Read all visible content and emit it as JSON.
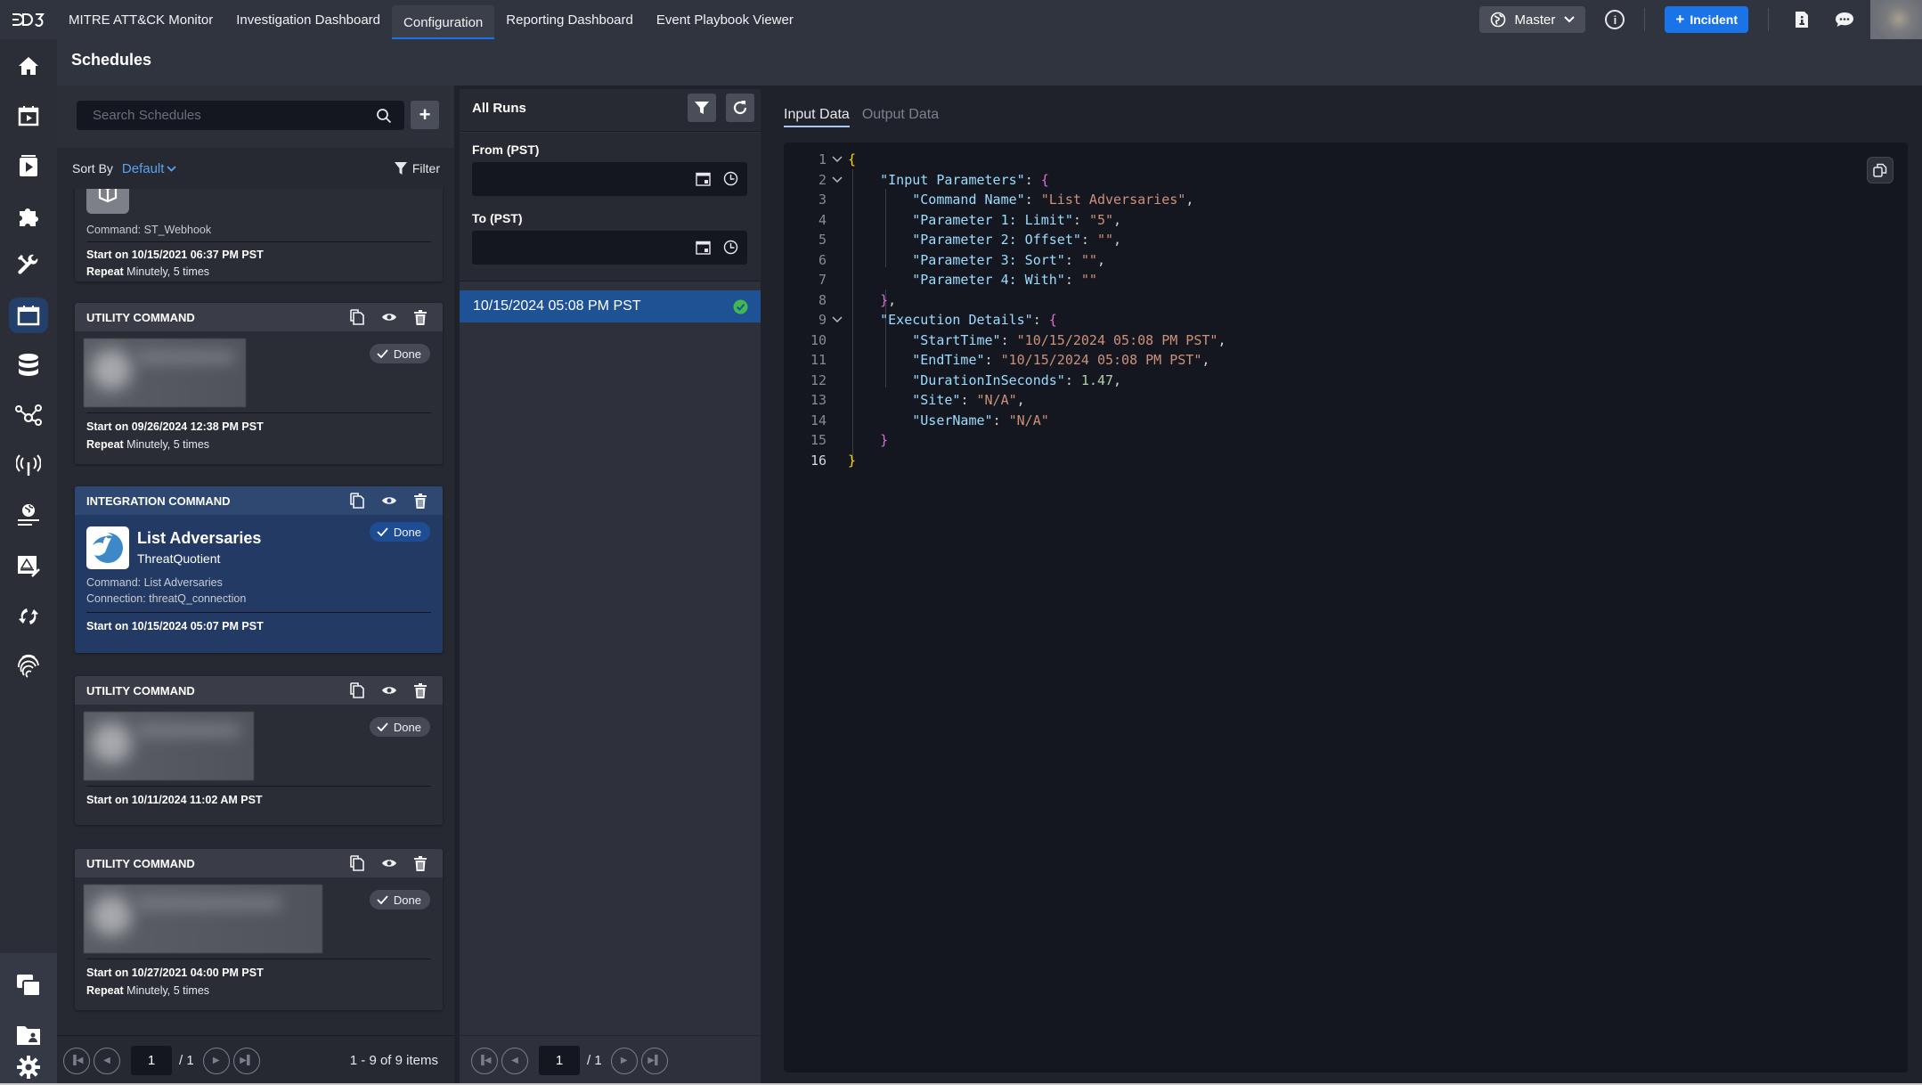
{
  "topbar": {
    "logo": "D3",
    "tabs": [
      {
        "label": "MITRE ATT&CK Monitor",
        "active": false
      },
      {
        "label": "Investigation Dashboard",
        "active": false
      },
      {
        "label": "Configuration",
        "active": true
      },
      {
        "label": "Reporting Dashboard",
        "active": false
      },
      {
        "label": "Event Playbook Viewer",
        "active": false
      }
    ],
    "site_selector": "Master",
    "incident_button": "Incident",
    "icons": [
      "globe-icon",
      "info-icon",
      "plus-icon",
      "document-info-icon",
      "chat-icon",
      "user-avatar"
    ]
  },
  "leftrail": {
    "items": [
      {
        "icon": "home-icon"
      },
      {
        "icon": "calendar-play-icon"
      },
      {
        "icon": "playbook-icon"
      },
      {
        "icon": "puzzle-icon"
      },
      {
        "icon": "tools-icon"
      },
      {
        "icon": "calendar-icon",
        "active": true
      },
      {
        "icon": "database-icon"
      },
      {
        "icon": "network-icon"
      },
      {
        "icon": "antenna-icon"
      },
      {
        "icon": "globe-desk-icon"
      },
      {
        "icon": "alert-edit-icon"
      },
      {
        "icon": "sync-icon"
      },
      {
        "icon": "fingerprint-icon"
      }
    ],
    "bottom_items": [
      {
        "icon": "windows-icon"
      },
      {
        "icon": "user-folder-icon"
      },
      {
        "icon": "gear-icon"
      }
    ]
  },
  "page": {
    "title": "Schedules"
  },
  "schedules": {
    "search_placeholder": "Search Schedules",
    "search_value": "",
    "sort_label": "Sort By",
    "sort_value": "Default",
    "filter_label": "Filter",
    "cards": [
      {
        "title_partial": "–",
        "command": "Command: ST_Webhook",
        "start": "Start on 10/15/2021 06:37 PM PST",
        "repeat_label": "Repeat",
        "repeat_value": "Minutely, 5 times"
      },
      {
        "type": "UTILITY COMMAND",
        "status": "Done",
        "start": "Start on 09/26/2024 12:38 PM PST",
        "repeat_label": "Repeat",
        "repeat_value": "Minutely, 5 times"
      },
      {
        "type": "INTEGRATION COMMAND",
        "status": "Done",
        "name": "List Adversaries",
        "integration": "ThreatQuotient",
        "command": "Command: List Adversaries",
        "connection": "Connection: threatQ_connection",
        "start": "Start on 10/15/2024 05:07 PM PST",
        "selected": true
      },
      {
        "type": "UTILITY COMMAND",
        "status": "Done",
        "start": "Start on 10/11/2024 11:02 AM PST"
      },
      {
        "type": "UTILITY COMMAND",
        "status": "Done",
        "start": "Start on 10/27/2021 04:00 PM PST",
        "repeat_label": "Repeat",
        "repeat_value": "Minutely, 5 times"
      }
    ],
    "pager": {
      "page": "1",
      "total": "/ 1",
      "count": "1 - 9 of 9 items"
    }
  },
  "runs": {
    "title": "All Runs",
    "from_label": "From (PST)",
    "from_value": "",
    "to_label": "To (PST)",
    "to_value": "",
    "items": [
      {
        "time": "10/15/2024 05:08 PM PST",
        "status": "success",
        "selected": true
      }
    ],
    "pager": {
      "page": "1",
      "total": "/ 1"
    }
  },
  "detail": {
    "tabs": [
      {
        "label": "Input Data",
        "active": true
      },
      {
        "label": "Output Data",
        "active": false
      }
    ],
    "json": {
      "Input Parameters": {
        "Command Name": "List Adversaries",
        "Parameter 1: Limit": "5",
        "Parameter 2: Offset": "",
        "Parameter 3: Sort": "",
        "Parameter 4: With": ""
      },
      "Execution Details": {
        "StartTime": "10/15/2024 05:08 PM PST",
        "EndTime": "10/15/2024 05:08 PM PST",
        "DurationInSeconds": 1.47,
        "Site": "N/A",
        "UserName": "N/A"
      }
    },
    "line_count": 16,
    "current_line": 16
  },
  "colors": {
    "accent": "#1a73e8",
    "selected_card": "#233b64",
    "selected_run": "#1e5294",
    "success": "#3fb950",
    "link": "#5aa2f0"
  }
}
